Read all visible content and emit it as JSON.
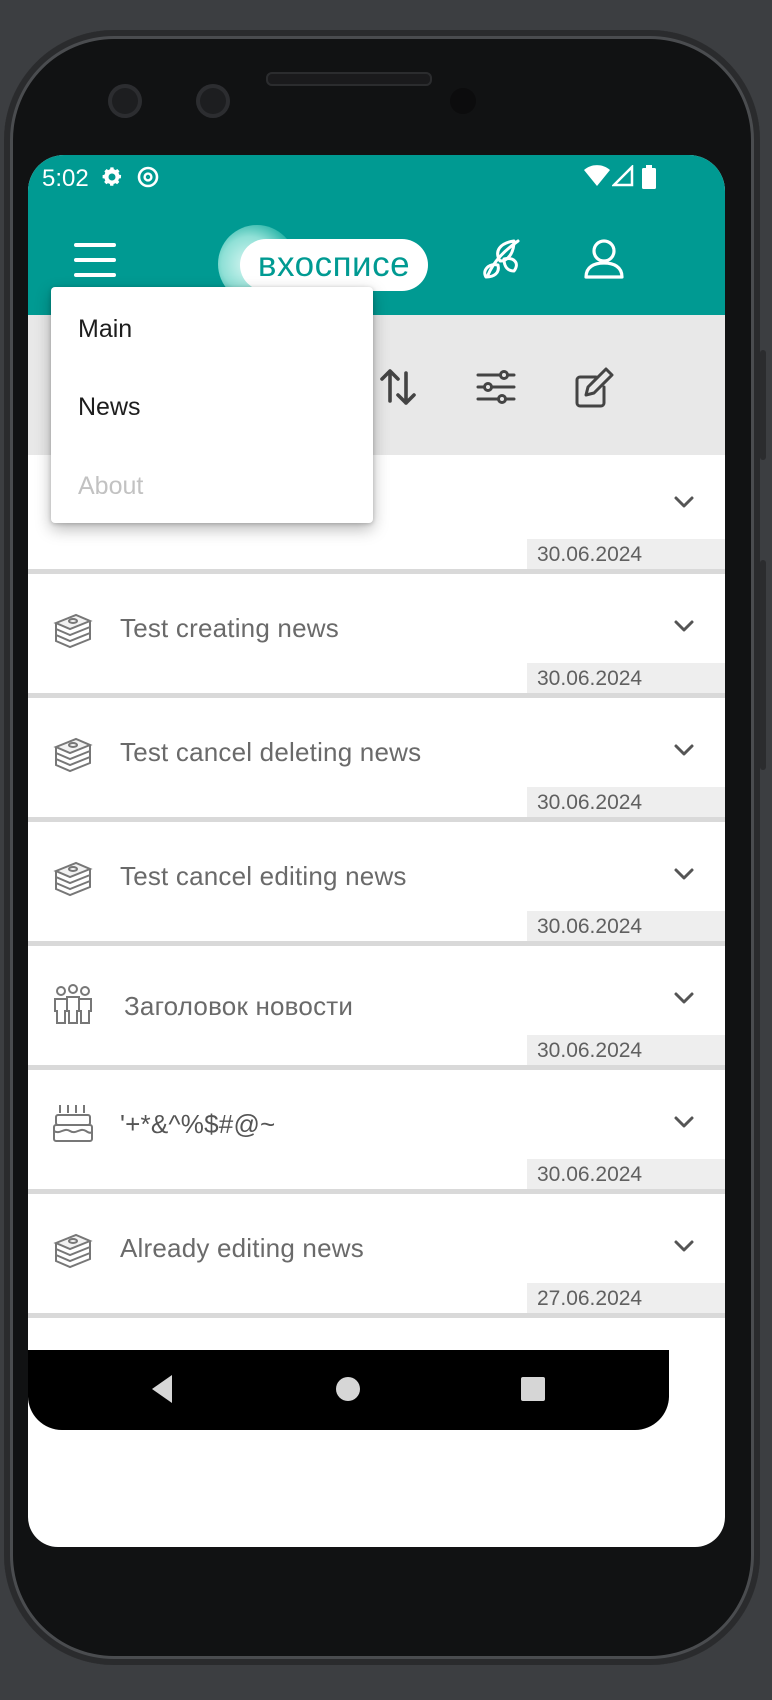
{
  "status_bar": {
    "time": "5:02",
    "icons": [
      "settings-icon",
      "at-sign-icon",
      "wifi-icon",
      "signal-icon",
      "battery-icon"
    ]
  },
  "app_bar": {
    "logo_text": "вхосписе",
    "icons": [
      "menu-icon",
      "butterfly-icon",
      "profile-icon"
    ]
  },
  "toolbar": {
    "icons": [
      "sort-icon",
      "filter-icon",
      "edit-icon"
    ]
  },
  "menu": {
    "items": [
      {
        "label": "Main",
        "enabled": true
      },
      {
        "label": "News",
        "enabled": true
      },
      {
        "label": "About",
        "enabled": false
      }
    ]
  },
  "news": [
    {
      "icon": "money-stack-icon",
      "title": "",
      "date": "30.06.2024"
    },
    {
      "icon": "money-stack-icon",
      "title": "Test creating news",
      "date": "30.06.2024"
    },
    {
      "icon": "money-stack-icon",
      "title": "Test cancel deleting news",
      "date": "30.06.2024"
    },
    {
      "icon": "money-stack-icon",
      "title": "Test cancel editing news",
      "date": "30.06.2024"
    },
    {
      "icon": "people-icon",
      "title": "Заголовок новости",
      "date": "30.06.2024"
    },
    {
      "icon": "cake-icon",
      "title": "'+*&^%$#@~",
      "date": "30.06.2024"
    },
    {
      "icon": "money-stack-icon",
      "title": "Already editing news",
      "date": "27.06.2024"
    }
  ],
  "colors": {
    "primary": "#009a92",
    "toolbar_bg": "#e8e8e8",
    "date_bg": "#eeeeee"
  }
}
